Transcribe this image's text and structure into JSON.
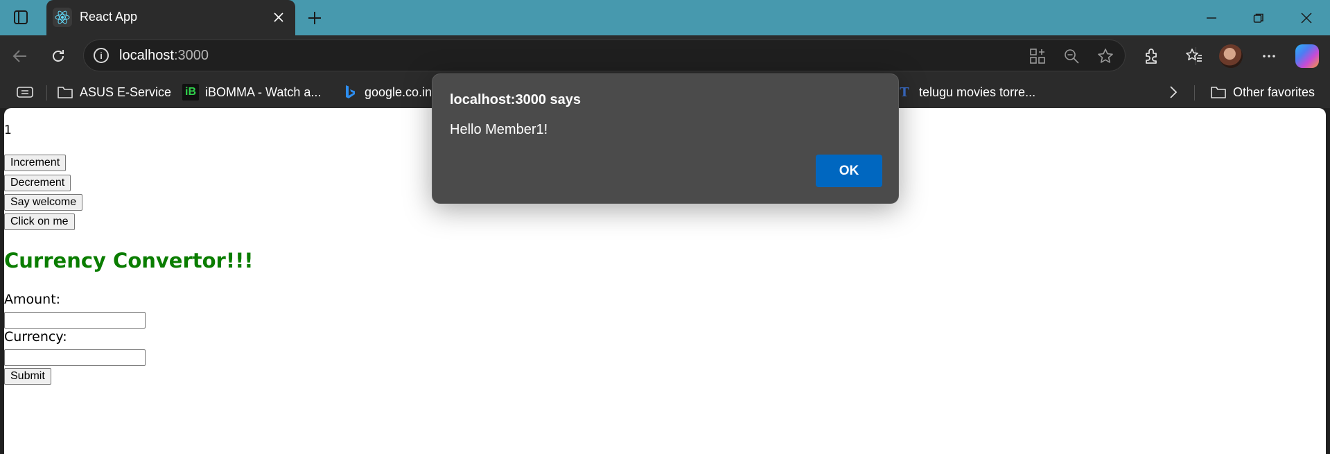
{
  "browser": {
    "tab": {
      "title": "React App",
      "icon": "react-logo-icon"
    },
    "address": {
      "host": "localhost",
      "port": ":3000"
    },
    "favorites": [
      {
        "label": "ASUS E-Service",
        "icon": "folder-icon"
      },
      {
        "label": "iBOMMA - Watch a...",
        "icon": "ibomma-icon",
        "glyph": "iB"
      },
      {
        "label": "google.co.in",
        "icon": "bing-icon"
      },
      {
        "label": "telugu movies torre...",
        "icon": "tm-icon",
        "glyph": "T"
      }
    ],
    "other_favorites": "Other favorites"
  },
  "page": {
    "counter": "1",
    "buttons": {
      "increment": "Increment",
      "decrement": "Decrement",
      "say_welcome": "Say welcome",
      "click_on_me": "Click on me"
    },
    "heading": "Currency Convertor!!!",
    "form": {
      "amount_label": "Amount:",
      "amount_value": "",
      "currency_label": "Currency:",
      "currency_value": "",
      "submit": "Submit"
    }
  },
  "dialog": {
    "title": "localhost:3000 says",
    "message": "Hello Member1!",
    "ok": "OK"
  },
  "colors": {
    "titlebar": "#4799ae",
    "heading_green": "#0a7d00",
    "ok_blue": "#0067c0"
  }
}
